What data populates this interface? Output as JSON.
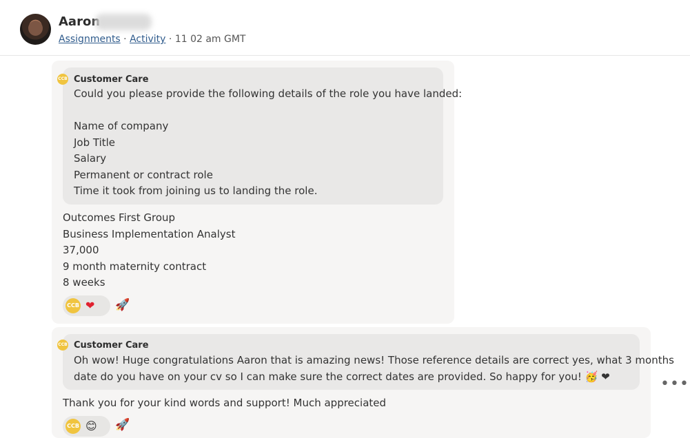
{
  "header": {
    "name": "Aaron",
    "assignments_link": "Assignments",
    "separator1": " · ",
    "activity_link": "Activity",
    "separator2": " · ",
    "time": "11 02 am GMT"
  },
  "messages": [
    {
      "quote": {
        "badge": "CCB",
        "author": "Customer Care",
        "lines": [
          "Could you please provide the following details of the role you have landed:",
          "",
          "Name of company",
          "Job Title",
          "Salary",
          "Permanent or contract role",
          "Time it took from joining us to landing the role."
        ]
      },
      "reply_lines": [
        "Outcomes First Group",
        "Business Implementation Analyst",
        "37,000",
        "9 month maternity contract",
        "8 weeks"
      ],
      "reaction": {
        "badge": "CCB",
        "emoji": "❤"
      }
    },
    {
      "quote": {
        "badge": "CCB",
        "author": "Customer Care",
        "lines": [
          "Oh wow! Huge congratulations Aaron that is amazing news! Those reference details are correct yes, what 3 months",
          "date do you have on your cv so I can make sure the correct dates are provided. So happy for you! 🥳 ❤"
        ]
      },
      "reply_lines": [
        "Thank you for your kind words and support! Much appreciated"
      ],
      "reaction": {
        "badge": "CCB",
        "emoji": "😊"
      }
    }
  ],
  "icons": {
    "add_reaction": "🚀",
    "more": "•••"
  }
}
